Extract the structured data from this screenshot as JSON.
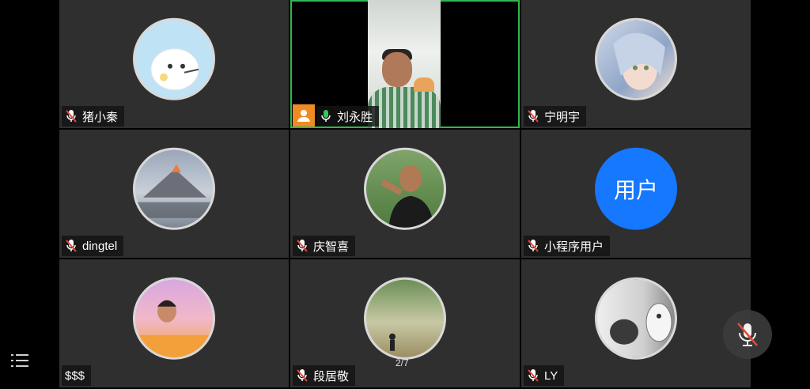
{
  "participants": [
    {
      "name": "猪小秦",
      "mic": "muted",
      "avatar": "cartoon"
    },
    {
      "name": "刘永胜",
      "mic": "on",
      "avatar": "video",
      "speaking": true
    },
    {
      "name": "宁明宇",
      "mic": "muted",
      "avatar": "anime"
    },
    {
      "name": "dingtel",
      "mic": "muted",
      "avatar": "volcano"
    },
    {
      "name": "庆智喜",
      "mic": "muted",
      "avatar": "photo"
    },
    {
      "name": "小程序用户",
      "mic": "muted",
      "avatar": "text",
      "avatar_text": "用户"
    },
    {
      "name": "$$$",
      "mic": "none",
      "avatar": "pink"
    },
    {
      "name": "段居敬",
      "mic": "muted",
      "avatar": "landscape"
    },
    {
      "name": "LY",
      "mic": "muted",
      "avatar": "cat"
    }
  ],
  "page_indicator": "2/7",
  "icons": {
    "menu": "list-menu-icon",
    "mute_toggle": "mic-muted-icon"
  },
  "colors": {
    "tile_bg": "#2f2f2f",
    "speaking_border": "#2fb84f",
    "muted_red": "#e8473b",
    "mic_green": "#34c759",
    "avatar_blue": "#1677ff"
  }
}
